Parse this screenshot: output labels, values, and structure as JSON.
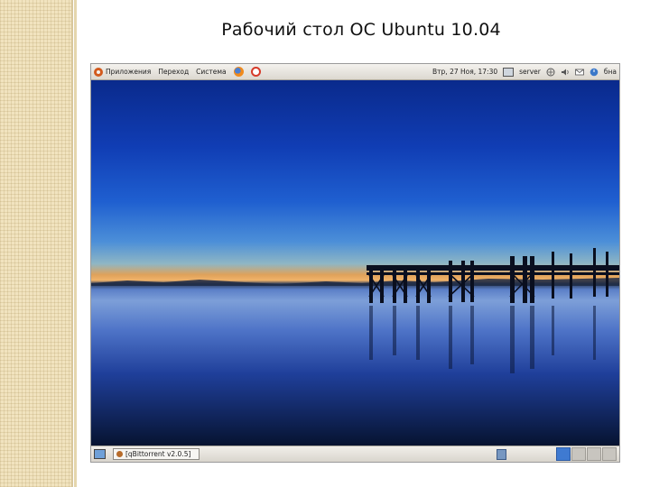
{
  "slide": {
    "title": "Рабочий стол ОС Ubuntu 10.04"
  },
  "top_panel": {
    "menus": [
      "Приложения",
      "Переход",
      "Система"
    ],
    "clock": "Втр, 27 Ноя, 17:30",
    "user": "server",
    "partial_label": "бна",
    "icons": [
      "ubuntu-logo-icon",
      "firefox-icon",
      "help-icon",
      "monitor-icon",
      "network-icon",
      "volume-icon",
      "mail-icon",
      "power-icon"
    ]
  },
  "bottom_panel": {
    "task_label": "[qBittorrent v2.0.5]",
    "workspaces": 4,
    "active_workspace": 1
  },
  "colors": {
    "ubuntu_orange": "#d25a1e",
    "panel_gray": "#dcd8d0",
    "workspace_active": "#3f7ad1"
  }
}
